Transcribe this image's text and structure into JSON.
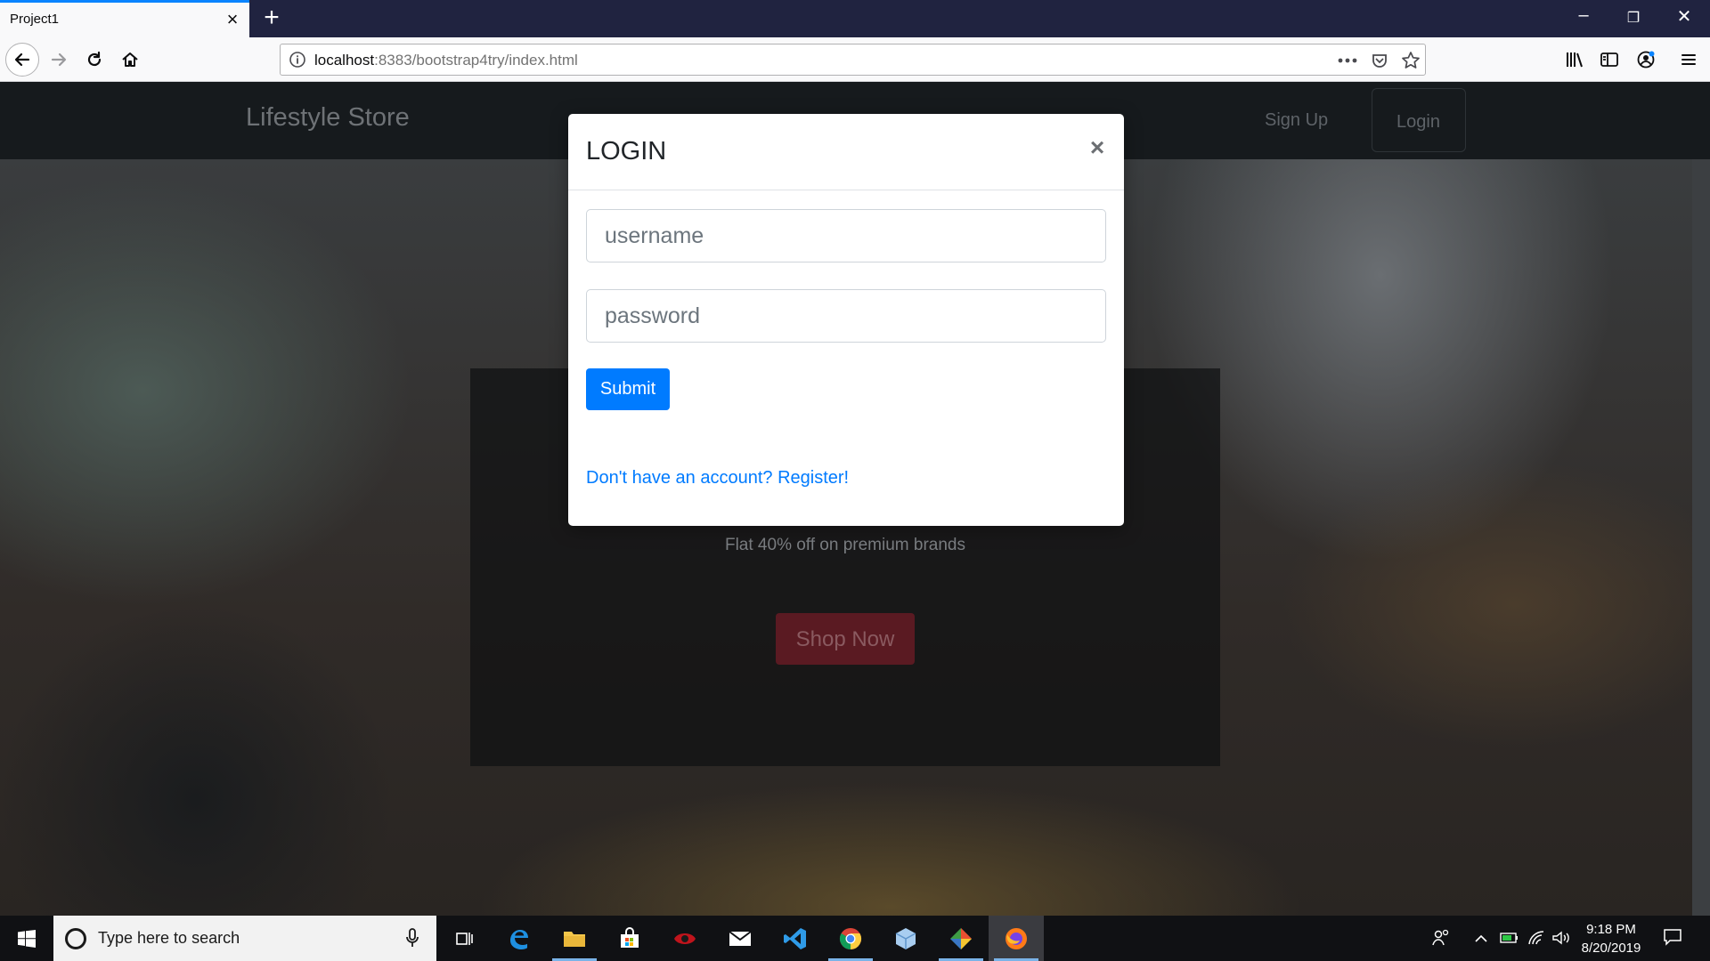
{
  "browser": {
    "tab_title": "Project1",
    "url_host": "localhost",
    "url_rest": ":8383/bootstrap4try/index.html"
  },
  "site": {
    "brand": "Lifestyle Store",
    "nav": {
      "signup": "Sign Up",
      "login": "Login"
    },
    "hero": {
      "subtitle": "Flat 40% off on premium brands",
      "button": "Shop Now"
    }
  },
  "modal": {
    "title": "LOGIN",
    "close": "×",
    "username_placeholder": "username",
    "password_placeholder": "password",
    "submit": "Submit",
    "register_link": "Don't have an account? Register!"
  },
  "taskbar": {
    "search_placeholder": "Type here to search",
    "time": "9:18 PM",
    "date": "8/20/2019",
    "apps": [
      "task-view",
      "edge",
      "file-explorer",
      "store",
      "game",
      "mail",
      "vscode",
      "chrome",
      "box",
      "git",
      "firefox"
    ]
  },
  "colors": {
    "accent_blue": "#007bff",
    "tab_accent": "#0a84ff",
    "tabbar_bg": "#202340",
    "hero_button": "#5a1a22"
  }
}
